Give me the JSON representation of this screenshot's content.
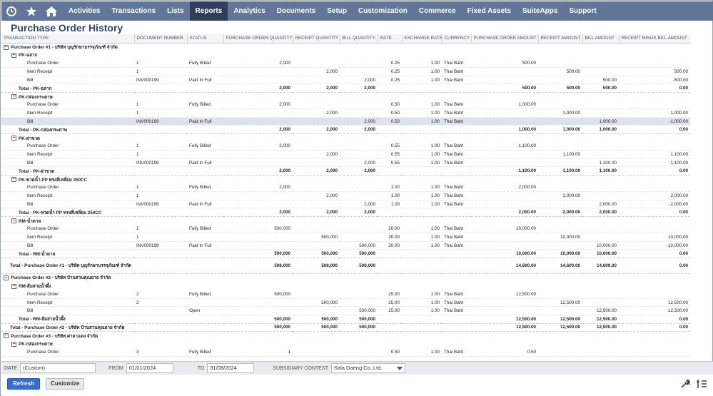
{
  "nav": {
    "items": [
      {
        "label": "Activities",
        "active": false
      },
      {
        "label": "Transactions",
        "active": false
      },
      {
        "label": "Lists",
        "active": false
      },
      {
        "label": "Reports",
        "active": true
      },
      {
        "label": "Analytics",
        "active": false
      },
      {
        "label": "Documents",
        "active": false
      },
      {
        "label": "Setup",
        "active": false
      },
      {
        "label": "Customization",
        "active": false
      },
      {
        "label": "Commerce",
        "active": false
      },
      {
        "label": "Fixed Assets",
        "active": false
      },
      {
        "label": "SuiteApps",
        "active": false
      },
      {
        "label": "Support",
        "active": false
      }
    ]
  },
  "page": {
    "title": "Purchase Order History"
  },
  "table": {
    "headers": [
      "TRANSACTION TYPE",
      "DOCUMENT NUMBER",
      "STATUS",
      "PURCHASE ORDER QUANTITY",
      "RECEIPT QUANTITY",
      "BILL QUANTITY",
      "RATE",
      "EXCHANGE RATE",
      "CURRENCY",
      "PURCHASE ORDER AMOUNT",
      "RECEIPT AMOUNT",
      "BILL AMOUNT",
      "RECEIPT MINUS BILL AMOUNT"
    ],
    "rows": [
      {
        "kind": "group",
        "level": 0,
        "expander": "⊟",
        "cells": [
          "Purchase Order #1 - บริษัท บุญรักษาบรรจุภัณฑ์ จำกัด",
          "",
          "",
          "",
          "",
          "",
          "",
          "",
          "",
          "",
          "",
          "",
          ""
        ]
      },
      {
        "kind": "group",
        "level": 1,
        "expander": "⊟",
        "cells": [
          "PK-ฉลาก",
          "",
          "",
          "",
          "",
          "",
          "",
          "",
          "",
          "",
          "",
          "",
          ""
        ]
      },
      {
        "kind": "detail",
        "level": 2,
        "cells": [
          "Purchase Order",
          "1",
          "Fully Billed",
          "2,000",
          "",
          "",
          "0.25",
          "1.00",
          "Thai Baht",
          "500.00",
          "",
          "",
          ""
        ]
      },
      {
        "kind": "detail",
        "level": 2,
        "cells": [
          "Item Receipt",
          "1",
          "",
          "",
          "2,000",
          "",
          "0.25",
          "1.00",
          "Thai Baht",
          "",
          "500.00",
          "",
          "500.00"
        ]
      },
      {
        "kind": "detail",
        "level": 2,
        "cells": [
          "Bill",
          "INV000199",
          "Paid In Full",
          "",
          "",
          "2,000",
          "0.25",
          "1.00",
          "Thai Baht",
          "",
          "",
          "500.00",
          "-500.00"
        ]
      },
      {
        "kind": "total",
        "level": 1,
        "cells": [
          "Total - PK-ฉลาก",
          "",
          "",
          "2,000",
          "2,000",
          "2,000",
          "",
          "",
          "",
          "500.00",
          "500.00",
          "500.00",
          "0.00"
        ]
      },
      {
        "kind": "group",
        "level": 1,
        "expander": "⊟",
        "cells": [
          "PK-กล่องกระดาษ",
          "",
          "",
          "",
          "",
          "",
          "",
          "",
          "",
          "",
          "",
          "",
          ""
        ]
      },
      {
        "kind": "detail",
        "level": 2,
        "cells": [
          "Purchase Order",
          "1",
          "Fully Billed",
          "2,000",
          "",
          "",
          "0.50",
          "1.00",
          "Thai Baht",
          "1,000.00",
          "",
          "",
          ""
        ]
      },
      {
        "kind": "detail",
        "level": 2,
        "cells": [
          "Item Receipt",
          "1",
          "",
          "",
          "2,000",
          "",
          "0.50",
          "1.00",
          "Thai Baht",
          "",
          "1,000.00",
          "",
          "1,000.00"
        ]
      },
      {
        "kind": "detail",
        "level": 2,
        "highlight": true,
        "cells": [
          "Bill",
          "INV000199",
          "Paid In Full",
          "",
          "",
          "2,000",
          "0.50",
          "1.00",
          "Thai Baht",
          "",
          "",
          "1,000.00",
          "-1,000.00"
        ]
      },
      {
        "kind": "total",
        "level": 1,
        "cells": [
          "Total - PK-กล่องกระดาษ",
          "",
          "",
          "2,000",
          "2,000",
          "2,000",
          "",
          "",
          "",
          "1,000.00",
          "1,000.00",
          "1,000.00",
          "0.00"
        ]
      },
      {
        "kind": "group",
        "level": 1,
        "expander": "⊟",
        "cells": [
          "PK-ฝาขวด",
          "",
          "",
          "",
          "",
          "",
          "",
          "",
          "",
          "",
          "",
          "",
          ""
        ]
      },
      {
        "kind": "detail",
        "level": 2,
        "cells": [
          "Purchase Order",
          "1",
          "Fully Billed",
          "2,000",
          "",
          "",
          "0.55",
          "1.00",
          "Thai Baht",
          "1,100.00",
          "",
          "",
          ""
        ]
      },
      {
        "kind": "detail",
        "level": 2,
        "cells": [
          "Item Receipt",
          "1",
          "",
          "",
          "2,000",
          "",
          "0.55",
          "1.00",
          "Thai Baht",
          "",
          "1,100.00",
          "",
          "1,100.00"
        ]
      },
      {
        "kind": "detail",
        "level": 2,
        "cells": [
          "Bill",
          "INV000199",
          "Paid In Full",
          "",
          "",
          "2,000",
          "0.55",
          "1.00",
          "Thai Baht",
          "",
          "",
          "1,100.00",
          "-1,100.00"
        ]
      },
      {
        "kind": "total",
        "level": 1,
        "cells": [
          "Total - PK-ฝาขวด",
          "",
          "",
          "2,000",
          "2,000",
          "2,000",
          "",
          "",
          "",
          "1,100.00",
          "1,100.00",
          "1,100.00",
          "0.00"
        ]
      },
      {
        "kind": "group",
        "level": 1,
        "expander": "⊟",
        "cells": [
          "PK-ขวดน้ำ PP ทรงสี่เหลี่ยม 250CC",
          "",
          "",
          "",
          "",
          "",
          "",
          "",
          "",
          "",
          "",
          "",
          ""
        ]
      },
      {
        "kind": "detail",
        "level": 2,
        "cells": [
          "Purchase Order",
          "1",
          "Fully Billed",
          "2,000",
          "",
          "",
          "1.00",
          "1.00",
          "Thai Baht",
          "2,000.00",
          "",
          "",
          ""
        ]
      },
      {
        "kind": "detail",
        "level": 2,
        "cells": [
          "Item Receipt",
          "1",
          "",
          "",
          "2,000",
          "",
          "1.00",
          "1.00",
          "Thai Baht",
          "",
          "2,000.00",
          "",
          "2,000.00"
        ]
      },
      {
        "kind": "detail",
        "level": 2,
        "cells": [
          "Bill",
          "INV000199",
          "Paid In Full",
          "",
          "",
          "2,000",
          "1.00",
          "1.00",
          "Thai Baht",
          "",
          "",
          "2,000.00",
          "-2,000.00"
        ]
      },
      {
        "kind": "total",
        "level": 1,
        "cells": [
          "Total - PK-ขวดน้ำ PP ทรงสี่เหลี่ยม 250CC",
          "",
          "",
          "2,000",
          "2,000",
          "2,000",
          "",
          "",
          "",
          "2,000.00",
          "2,000.00",
          "2,000.00",
          "0.00"
        ]
      },
      {
        "kind": "group",
        "level": 1,
        "expander": "⊟",
        "cells": [
          "RM-น้ำตาล",
          "",
          "",
          "",
          "",
          "",
          "",
          "",
          "",
          "",
          "",
          "",
          ""
        ]
      },
      {
        "kind": "detail",
        "level": 2,
        "cells": [
          "Purchase Order",
          "1",
          "Fully Billed",
          "500,000",
          "",
          "",
          "20.00",
          "1.00",
          "Thai Baht",
          "10,000.00",
          "",
          "",
          ""
        ]
      },
      {
        "kind": "detail",
        "level": 2,
        "cells": [
          "Item Receipt",
          "1",
          "",
          "",
          "500,000",
          "",
          "20.00",
          "1.00",
          "Thai Baht",
          "",
          "10,000.00",
          "",
          "10,000.00"
        ]
      },
      {
        "kind": "detail",
        "level": 2,
        "cells": [
          "Bill",
          "INV000199",
          "Paid In Full",
          "",
          "",
          "500,000",
          "20.00",
          "1.00",
          "Thai Baht",
          "",
          "",
          "10,000.00",
          "-10,000.00"
        ]
      },
      {
        "kind": "total",
        "level": 1,
        "cells": [
          "Total - RM-น้ำตาล",
          "",
          "",
          "500,000",
          "500,000",
          "500,000",
          "",
          "",
          "",
          "10,000.00",
          "10,000.00",
          "10,000.00",
          "0.00"
        ]
      },
      {
        "kind": "total",
        "level": 0,
        "tall": true,
        "cells": [
          "Total - Purchase Order #1 - บริษัท บุญรักษาบรรจุภัณฑ์ จำกัด",
          "",
          "",
          "508,000",
          "508,000",
          "508,000",
          "",
          "",
          "",
          "14,600.00",
          "14,600.00",
          "14,600.00",
          "0.00"
        ]
      },
      {
        "kind": "group",
        "level": 0,
        "expander": "⊟",
        "cells": [
          "Purchase Order #2 - บริษัท บ้านสวนคุณยาย จำกัด",
          "",
          "",
          "",
          "",
          "",
          "",
          "",
          "",
          "",
          "",
          "",
          ""
        ]
      },
      {
        "kind": "group",
        "level": 1,
        "expander": "⊟",
        "cells": [
          "RM-ส้มสายน้ำผึ้ง",
          "",
          "",
          "",
          "",
          "",
          "",
          "",
          "",
          "",
          "",
          "",
          ""
        ]
      },
      {
        "kind": "detail",
        "level": 2,
        "cells": [
          "Purchase Order",
          "2",
          "Fully Billed",
          "500,000",
          "",
          "",
          "25.00",
          "1.00",
          "Thai Baht",
          "12,500.00",
          "",
          "",
          ""
        ]
      },
      {
        "kind": "detail",
        "level": 2,
        "cells": [
          "Item Receipt",
          "2",
          "",
          "",
          "500,000",
          "",
          "25.00",
          "1.00",
          "Thai Baht",
          "",
          "12,500.00",
          "",
          "12,500.00"
        ]
      },
      {
        "kind": "detail",
        "level": 2,
        "cells": [
          "Bill",
          "",
          "Open",
          "",
          "",
          "500,000",
          "25.00",
          "1.00",
          "Thai Baht",
          "",
          "",
          "12,500.00",
          "-12,500.00"
        ]
      },
      {
        "kind": "total",
        "level": 1,
        "cells": [
          "Total - RM-ส้มสายน้ำผึ้ง",
          "",
          "",
          "500,000",
          "500,000",
          "500,000",
          "",
          "",
          "",
          "12,500.00",
          "12,500.00",
          "12,500.00",
          "0.00"
        ]
      },
      {
        "kind": "total",
        "level": 0,
        "cells": [
          "Total - Purchase Order #2 - บริษัท บ้านสวนคุณยาย จำกัด",
          "",
          "",
          "500,000",
          "500,000",
          "500,000",
          "",
          "",
          "",
          "12,500.00",
          "12,500.00",
          "12,500.00",
          "0.00"
        ]
      },
      {
        "kind": "group",
        "level": 0,
        "expander": "⊟",
        "cells": [
          "Purchase Order #3 - บริษัท ศาลาแดง จำกัด",
          "",
          "",
          "",
          "",
          "",
          "",
          "",
          "",
          "",
          "",
          "",
          ""
        ]
      },
      {
        "kind": "group",
        "level": 1,
        "expander": "⊟",
        "cells": [
          "PK-กล่องกระดาษ",
          "",
          "",
          "",
          "",
          "",
          "",
          "",
          "",
          "",
          "",
          "",
          ""
        ]
      },
      {
        "kind": "detail",
        "level": 2,
        "cells": [
          "Purchase Order",
          "3",
          "Fully Billed",
          "1",
          "",
          "",
          "0.50",
          "1.00",
          "Thai Baht",
          "0.50",
          "",
          "",
          ""
        ]
      }
    ]
  },
  "filters": {
    "date_label": "DATE",
    "date_value": "(Custom)",
    "from_label": "FROM",
    "from_value": "01/01/2024",
    "to_label": "TO",
    "to_value": "31/08/2024",
    "subsidiary_label": "SUBSIDIARY CONTEXT",
    "subsidiary_value": "Sala Daeng Co.,Ltd."
  },
  "buttons": {
    "refresh": "Refresh",
    "customize": "Customize"
  },
  "icons": {
    "recent": "recent-records-icon",
    "star": "favorites-star-icon",
    "home": "home-icon",
    "wrench": "wrench-icon",
    "settings": "filter-settings-icon"
  },
  "colors": {
    "navbar": "#607799",
    "nav_active": "#2f3f59",
    "title": "#26476c",
    "primary_button": "#2f6fd6",
    "row_highlight": "#dde3ec"
  }
}
